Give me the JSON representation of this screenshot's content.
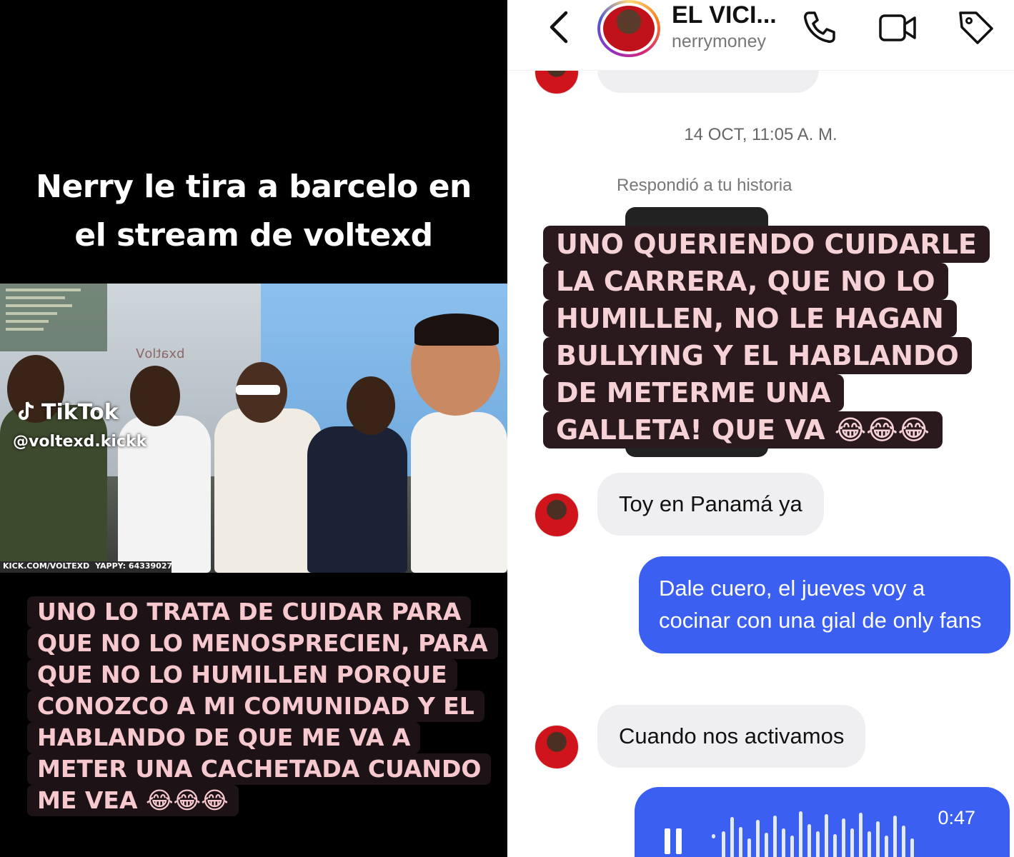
{
  "left_panel": {
    "caption_line1": "Nerry  le tira a barcelo en",
    "caption_line2": "el stream de voltexd",
    "tiktok_brand": "TikTok",
    "tiktok_handle": "@voltexd.kickk",
    "stream_bar_left": "KICK.COM/VOLTEXD",
    "stream_bar_right": "YAPPY: 64339027",
    "video_watermark": "bxatloV",
    "quote_lines": [
      "UNO LO TRATA DE CUIDAR PARA",
      "QUE NO LO MENOSPRECIEN, PARA",
      "QUE NO LO HUMILLEN PORQUE",
      "CONOZCO A MI COMUNIDAD Y EL",
      "HABLANDO DE QUE ME VA A",
      "METER UNA CACHETADA CUANDO",
      "ME VEA 😂😂😂"
    ]
  },
  "right_panel": {
    "header": {
      "title": "EL VICI...",
      "username": "nerrymoney",
      "icons": [
        "back-chevron-icon",
        "phone-icon",
        "video-camera-icon",
        "tag-icon"
      ]
    },
    "timestamp": "14 OCT, 11:05 A. M.",
    "replied_label": "Respondió a tu historia",
    "quote_lines": [
      "UNO QUERIENDO CUIDARLE",
      "LA CARRERA, QUE NO LO",
      "HUMILLEN, NO LE HAGAN",
      "BULLYING Y EL HABLANDO",
      "DE METERME UNA",
      "GALLETA! QUE VA 😂😂😂"
    ],
    "messages": [
      {
        "from": "them",
        "text": "Toy en Panamá ya"
      },
      {
        "from": "me",
        "text": "Dale cuero, el jueves voy a cocinar con una gial de only fans"
      },
      {
        "from": "them",
        "text": "Cuando nos activamos"
      }
    ],
    "voice_note": {
      "duration": "0:47"
    },
    "colors": {
      "outgoing_bubble": "#3b5ff1",
      "incoming_bubble": "#efeff2",
      "quote_highlight": "#2a1a1d",
      "quote_text": "#f6d1d5"
    }
  }
}
